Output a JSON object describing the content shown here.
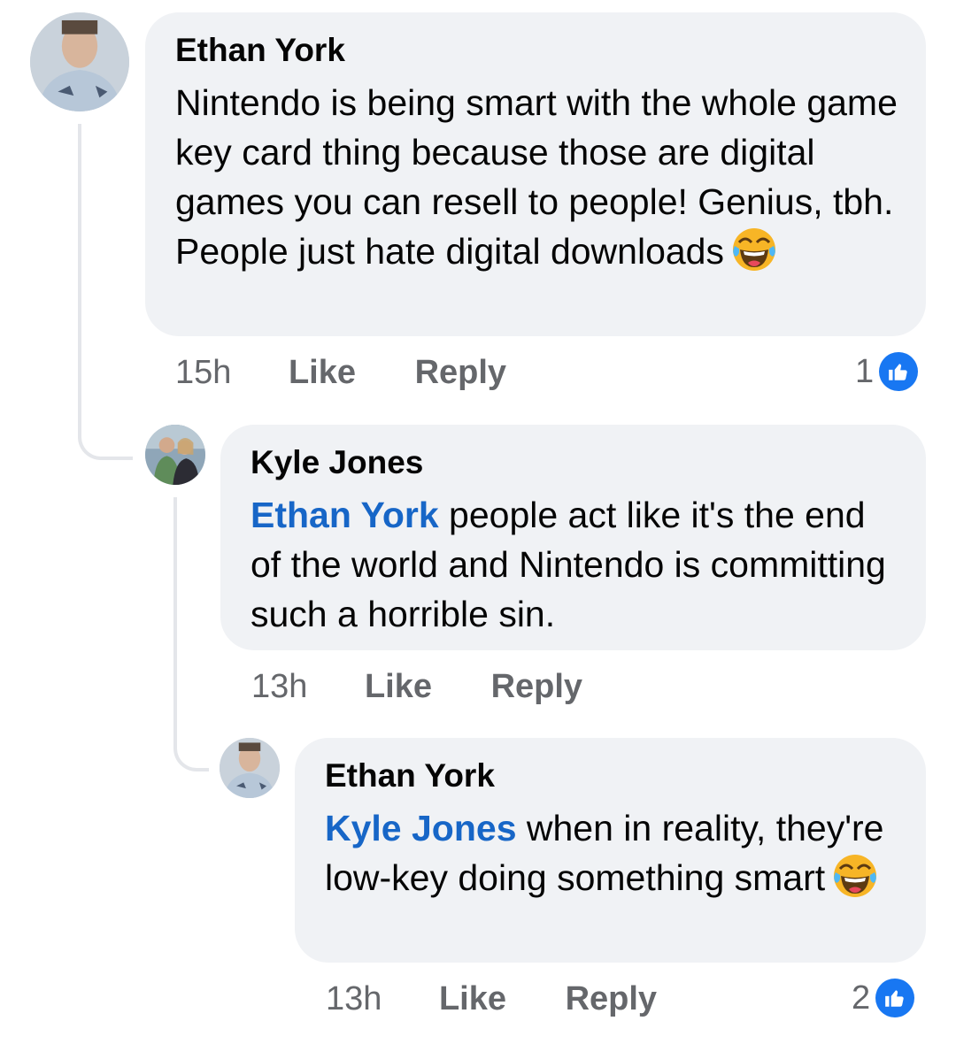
{
  "comments": [
    {
      "author": "Ethan York",
      "text": "Nintendo is being smart with the whole game key card thing because those are digital games you can resell to people! Genius, tbh. People just hate digital downloads",
      "emoji": "laughing-tears-emoji",
      "time": "15h",
      "like_label": "Like",
      "reply_label": "Reply",
      "reaction_count": "1"
    },
    {
      "author": "Kyle Jones",
      "mention": "Ethan York",
      "text": " people act like it's the end of the world and Nintendo is committing such a horrible sin.",
      "time": "13h",
      "like_label": "Like",
      "reply_label": "Reply"
    },
    {
      "author": "Ethan York",
      "mention": "Kyle Jones",
      "text": " when in reality, they're low-key doing something smart",
      "emoji": "laughing-tears-emoji",
      "time": "13h",
      "like_label": "Like",
      "reply_label": "Reply",
      "reaction_count": "2"
    }
  ],
  "colors": {
    "bubble": "#f0f2f5",
    "mention": "#1766c7",
    "like_badge": "#1877f2",
    "meta_text": "#65676b"
  }
}
